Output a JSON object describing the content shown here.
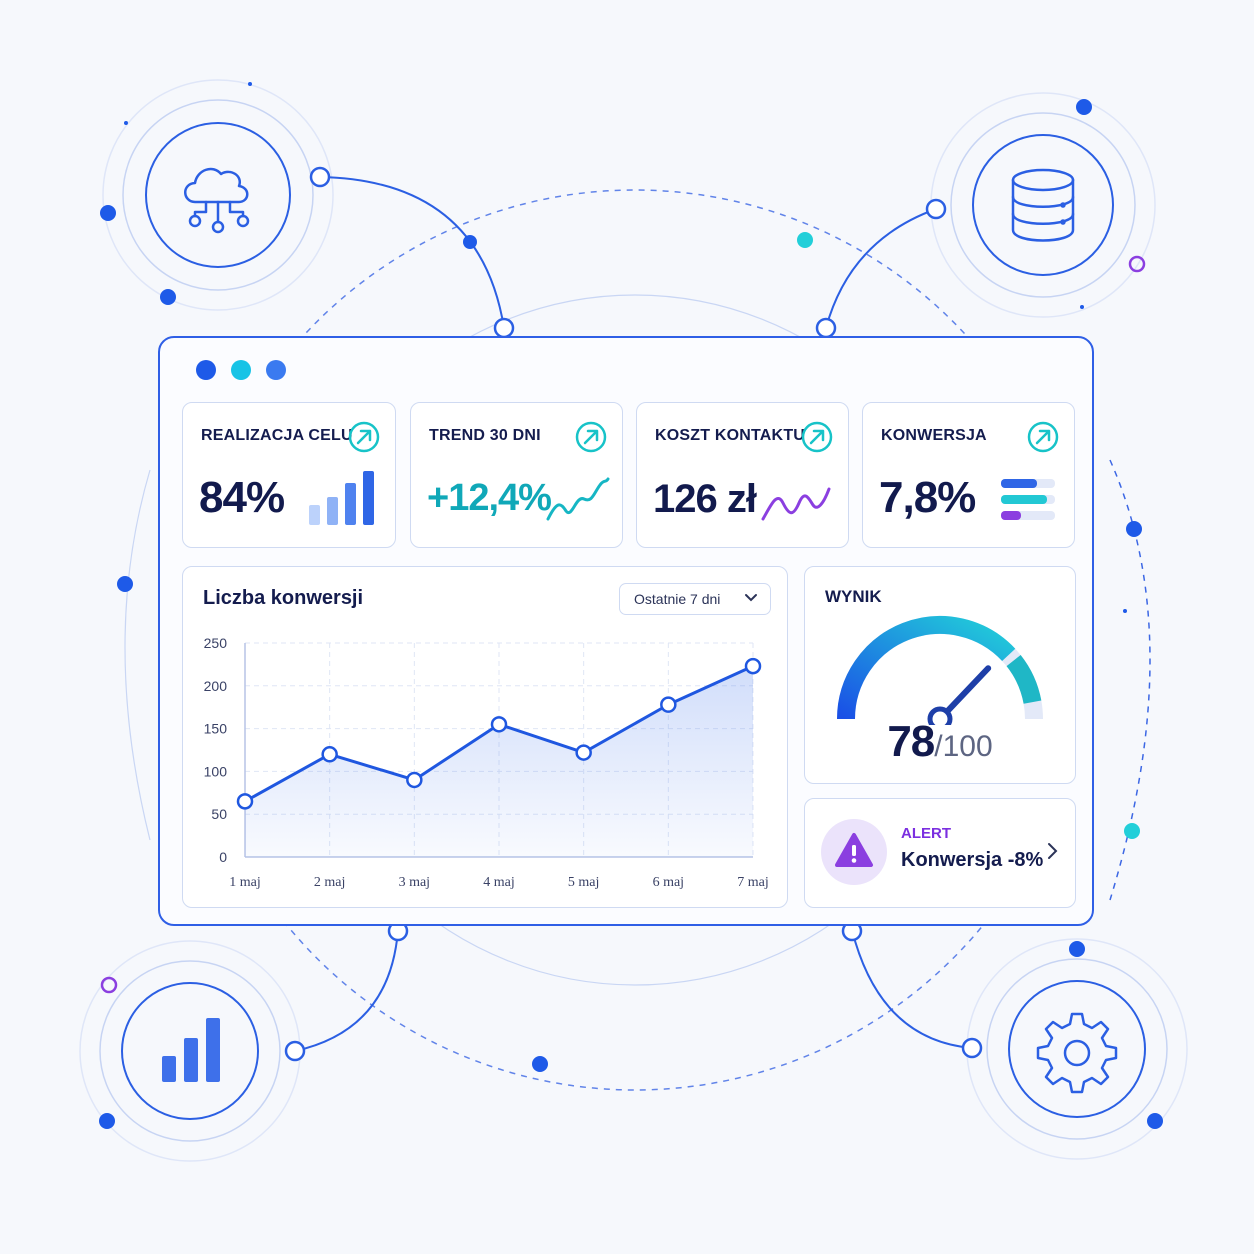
{
  "window": {
    "dot_colors": [
      "#1e5ae8",
      "#17c3e6",
      "#3a7af0"
    ]
  },
  "integration_icons": [
    "cloud-network-icon",
    "database-icon",
    "bar-chart-icon",
    "gear-icon"
  ],
  "kpis": [
    {
      "label": "REALIZACJA CELU",
      "value": "84%",
      "value_color": "#121a4d",
      "indicator": "bar-sparkline-icon"
    },
    {
      "label": "TREND 30 DNI",
      "value": "+12,4%",
      "value_color": "#10a8b8",
      "indicator": "teal-sparkline-icon"
    },
    {
      "label": "KOSZT KONTAKTU",
      "value": "126 zł",
      "value_color": "#121a4d",
      "indicator": "purple-sparkline-icon"
    },
    {
      "label": "KONWERSJA",
      "value": "7,8%",
      "value_color": "#121a4d",
      "indicator": "progress-bars-icon"
    }
  ],
  "kpi_arrow_color": "#17c3c8",
  "conversions_panel": {
    "title": "Liczba konwersji",
    "range_select": "Ostatnie 7 dni"
  },
  "chart_data": {
    "type": "area",
    "categories": [
      "1 maj",
      "2 maj",
      "3 maj",
      "4 maj",
      "5 maj",
      "6 maj",
      "7 maj"
    ],
    "values": [
      65,
      120,
      90,
      155,
      122,
      178,
      223
    ],
    "y_ticks": [
      0,
      50,
      100,
      150,
      200,
      250
    ],
    "ylim": [
      0,
      250
    ],
    "grid": true,
    "color": "#1f57e0"
  },
  "score_panel": {
    "label": "WYNIK",
    "value": "78",
    "max": "/100",
    "gauge_fraction": 0.78
  },
  "alert": {
    "label": "ALERT",
    "text": "Konwersja -8%"
  }
}
